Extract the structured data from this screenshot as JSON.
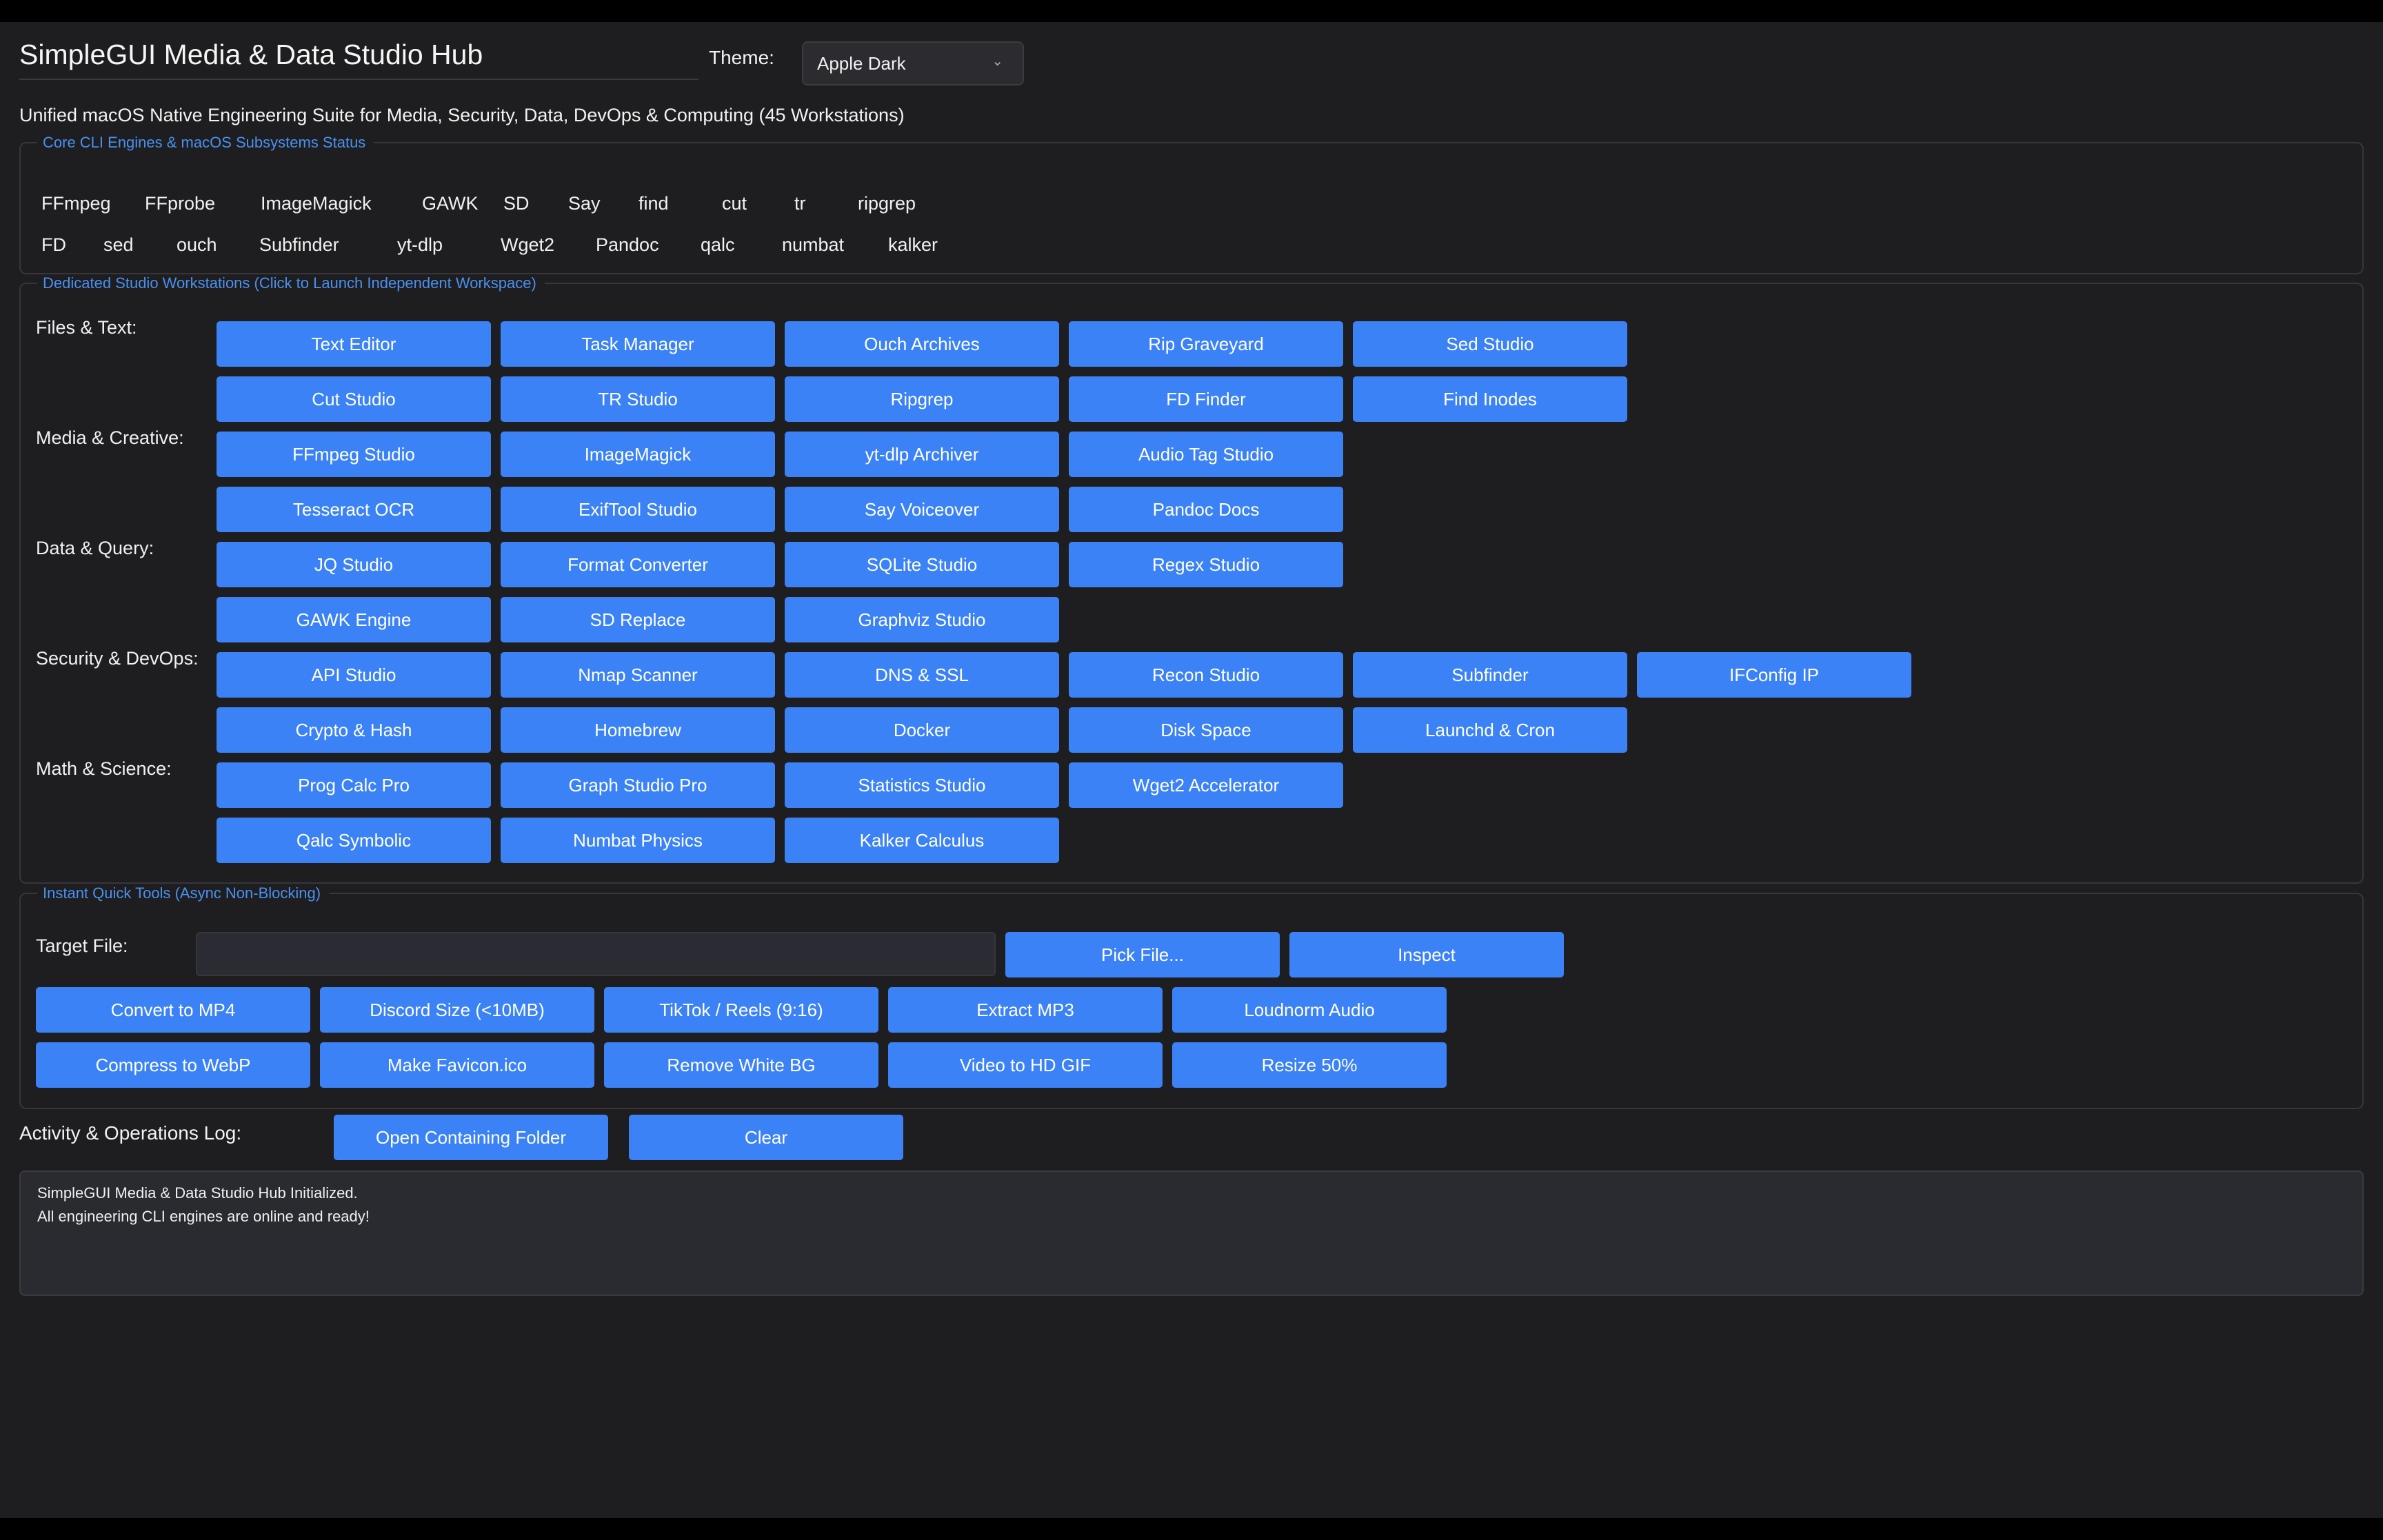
{
  "header": {
    "title": "SimpleGUI Media & Data Studio Hub",
    "theme_label": "Theme:",
    "theme_value": "Apple Dark",
    "subtitle": "Unified macOS Native Engineering Suite for Media, Security, Data, DevOps & Computing (45 Workstations)"
  },
  "engines": {
    "legend": "Core CLI Engines & macOS Subsystems Status",
    "row1": [
      "FFmpeg",
      "FFprobe",
      "ImageMagick",
      "GAWK",
      "SD",
      "Say",
      "find",
      "cut",
      "tr",
      "ripgrep"
    ],
    "row2": [
      "FD",
      "sed",
      "ouch",
      "Subfinder",
      "yt-dlp",
      "Wget2",
      "Pandoc",
      "qalc",
      "numbat",
      "kalker"
    ]
  },
  "studios": {
    "legend": "Dedicated Studio Workstations (Click to Launch Independent Workspace)",
    "categories": [
      {
        "label": "Files & Text:",
        "rows": [
          [
            "Text Editor",
            "Task Manager",
            "Ouch Archives",
            "Rip Graveyard",
            "Sed Studio"
          ],
          [
            "Cut Studio",
            "TR Studio",
            "Ripgrep",
            "FD Finder",
            "Find Inodes"
          ]
        ]
      },
      {
        "label": "Media & Creative:",
        "rows": [
          [
            "FFmpeg Studio",
            "ImageMagick",
            "yt-dlp Archiver",
            "Audio Tag Studio"
          ],
          [
            "Tesseract OCR",
            "ExifTool Studio",
            "Say Voiceover",
            "Pandoc Docs"
          ]
        ]
      },
      {
        "label": "Data & Query:",
        "rows": [
          [
            "JQ Studio",
            "Format Converter",
            "SQLite Studio",
            "Regex Studio"
          ],
          [
            "GAWK Engine",
            "SD Replace",
            "Graphviz Studio"
          ]
        ]
      },
      {
        "label": "Security & DevOps:",
        "rows": [
          [
            "API Studio",
            "Nmap Scanner",
            "DNS & SSL",
            "Recon Studio",
            "Subfinder",
            "IFConfig IP"
          ],
          [
            "Crypto & Hash",
            "Homebrew",
            "Docker",
            "Disk Space",
            "Launchd & Cron"
          ]
        ]
      },
      {
        "label": "Math & Science:",
        "rows": [
          [
            "Prog Calc Pro",
            "Graph Studio Pro",
            "Statistics Studio",
            "Wget2 Accelerator"
          ],
          [
            "Qalc Symbolic",
            "Numbat Physics",
            "Kalker Calculus"
          ]
        ]
      }
    ]
  },
  "quick": {
    "legend": "Instant Quick Tools (Async Non-Blocking)",
    "target_label": "Target File:",
    "target_value": "",
    "pick_label": "Pick File...",
    "inspect_label": "Inspect",
    "row1": [
      "Convert to MP4",
      "Discord Size (<10MB)",
      "TikTok / Reels (9:16)",
      "Extract MP3",
      "Loudnorm Audio"
    ],
    "row2": [
      "Compress to WebP",
      "Make Favicon.ico",
      "Remove White BG",
      "Video to HD GIF",
      "Resize 50%"
    ]
  },
  "log": {
    "label": "Activity & Operations Log:",
    "open_folder_label": "Open Containing Folder",
    "clear_label": "Clear",
    "lines": [
      "SimpleGUI Media & Data Studio Hub Initialized.",
      "All engineering CLI engines are online and ready!"
    ]
  },
  "colors": {
    "accent": "#3b82f6",
    "legend_text": "#4a90f0",
    "background": "#1e1e20"
  }
}
